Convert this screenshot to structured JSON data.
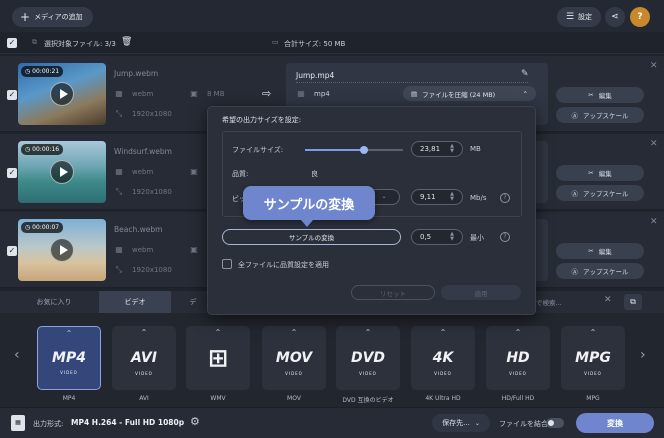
{
  "toolbar": {
    "add_media": "メディアの追加",
    "settings": "設定",
    "help": "?"
  },
  "selection": {
    "selected_label": "選択対象ファイル: 3/3",
    "total_size": "合計サイズ: 50 MB"
  },
  "files": [
    {
      "duration": "00:00:21",
      "name": "Jump.webm",
      "format": "webm",
      "size": "8 MB",
      "resolution": "1920x1080",
      "output_name": "Jump.mp4",
      "output_format": "mp4",
      "compress_label": "ファイルを圧縮 (24 MB)",
      "edit": "編集",
      "upscale": "アップスケール"
    },
    {
      "duration": "00:00:16",
      "name": "Windsurf.webm",
      "format": "webm",
      "size": "",
      "resolution": "1920x1080",
      "edit": "編集",
      "upscale": "アップスケール"
    },
    {
      "duration": "00:00:07",
      "name": "Beach.webm",
      "format": "webm",
      "size": "",
      "resolution": "1920x1080",
      "edit": "編集",
      "upscale": "アップスケール"
    }
  ],
  "modal": {
    "title": "希望の出力サイズを設定:",
    "file_size_label": "ファイルサイズ:",
    "file_size_value": "23,81",
    "file_size_unit": "MB",
    "file_size_fraction": 0.6,
    "quality_label": "品質:",
    "quality_value": "良",
    "bitrate_label": "ビッ",
    "bitrate_value": "9,11",
    "bitrate_unit": "Mb/s",
    "sample_button": "サンプルの変換",
    "sample_value": "0,5",
    "sample_unit": "最小",
    "apply_all": "全ファイルに品質設定を適用",
    "reset": "リセット",
    "apply": "適用"
  },
  "tooltip": "サンプルの変換",
  "tabs": [
    "お気に入り",
    "ビデオ",
    "デ"
  ],
  "search_placeholder": "で検索...",
  "formats": [
    {
      "logo": "MP4",
      "sub": "VIDEO",
      "label": "MP4"
    },
    {
      "logo": "AVI",
      "sub": "VIDEO",
      "label": "AVI"
    },
    {
      "logo": "⊞",
      "sub": "",
      "label": "WMV"
    },
    {
      "logo": "MOV",
      "sub": "VIDEO",
      "label": "MOV"
    },
    {
      "logo": "DVD",
      "sub": "VIDEO",
      "label": "DVD 互換のビデオ"
    },
    {
      "logo": "4K",
      "sub": "VIDEO",
      "label": "4K Ultra HD"
    },
    {
      "logo": "HD",
      "sub": "VIDEO",
      "label": "HD/Full HD"
    },
    {
      "logo": "MPG",
      "sub": "VIDEO",
      "label": "MPG"
    }
  ],
  "footer": {
    "output_label": "出力形式:",
    "output_value": "MP4 H.264 - Full HD 1080p",
    "save_to": "保存先...",
    "merge": "ファイルを結合:",
    "convert": "変換"
  },
  "colors": {
    "accent": "#6f86cf",
    "background": "#1f232b",
    "panel": "#262b35",
    "help": "#c8892c"
  }
}
